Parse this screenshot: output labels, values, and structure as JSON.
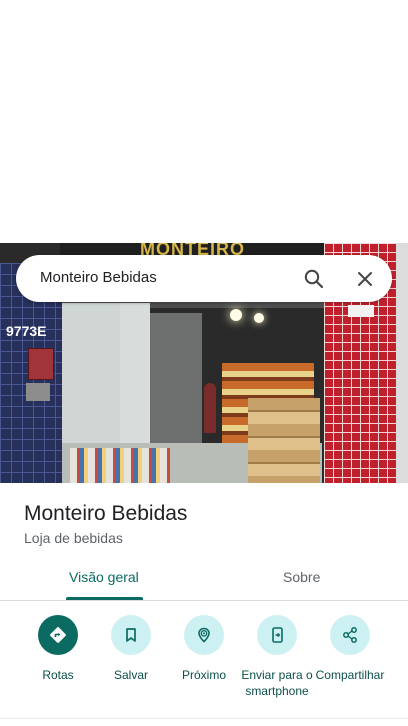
{
  "search": {
    "query": "Monteiro Bebidas",
    "search_icon": "search-icon",
    "close_icon": "close-icon"
  },
  "photo": {
    "sign_text": "MONTEIRO",
    "left_number": "9773E"
  },
  "place": {
    "name": "Monteiro Bebidas",
    "category": "Loja de bebidas"
  },
  "tabs": [
    {
      "label": "Visão geral",
      "active": true
    },
    {
      "label": "Sobre",
      "active": false
    }
  ],
  "actions": [
    {
      "label": "Rotas",
      "icon": "directions-icon"
    },
    {
      "label": "Salvar",
      "icon": "bookmark-icon"
    },
    {
      "label": "Próximo",
      "icon": "nearby-icon"
    },
    {
      "label": "Enviar para o smartphone",
      "icon": "send-to-phone-icon"
    },
    {
      "label": "Compartilhar",
      "icon": "share-icon"
    }
  ],
  "colors": {
    "accent": "#0b6b62",
    "action_bg": "#cdf1f3",
    "action_text": "#0b4f4a",
    "secondary_text": "#5f6368"
  }
}
